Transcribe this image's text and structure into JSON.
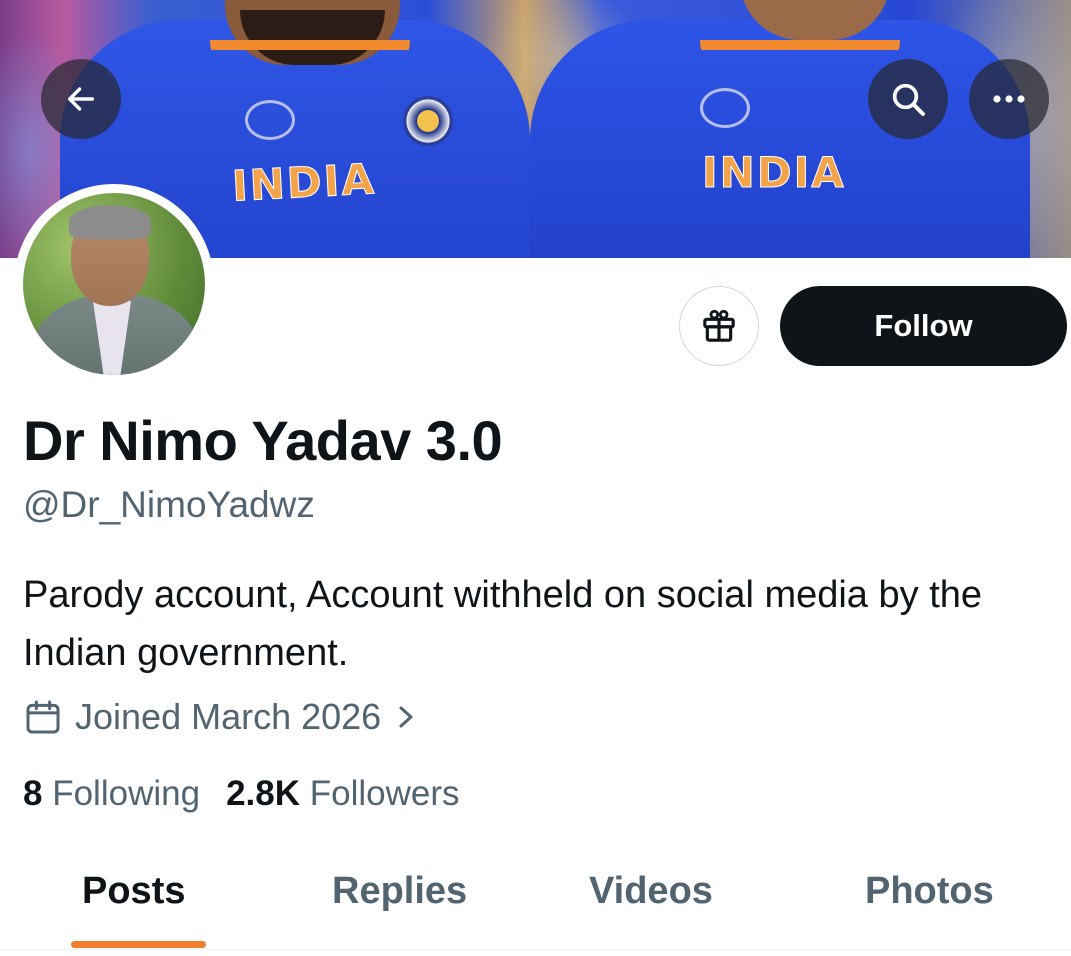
{
  "header": {
    "back_icon": "arrow-left-icon",
    "search_icon": "search-icon",
    "more_icon": "more-horizontal-icon"
  },
  "banner": {
    "jersey_text_left": "INDIA",
    "jersey_text_right": "INDIA"
  },
  "profile": {
    "display_name": "Dr Nimo Yadav 3.0",
    "handle": "@Dr_NimoYadwz",
    "bio": "Parody account, Account withheld on social media by the Indian government.",
    "joined": "Joined March 2026",
    "following_count": "8",
    "following_label": "Following",
    "followers_count": "2.8K",
    "followers_label": "Followers"
  },
  "actions": {
    "gift_icon": "gift-icon",
    "follow_label": "Follow"
  },
  "tabs": [
    {
      "label": "Posts",
      "active": true
    },
    {
      "label": "Replies",
      "active": false
    },
    {
      "label": "Videos",
      "active": false
    },
    {
      "label": "Photos",
      "active": false
    }
  ],
  "colors": {
    "text_primary": "#0f1419",
    "text_secondary": "#536471",
    "follow_bg": "#0f1419",
    "tab_indicator": "#f07e2a"
  }
}
